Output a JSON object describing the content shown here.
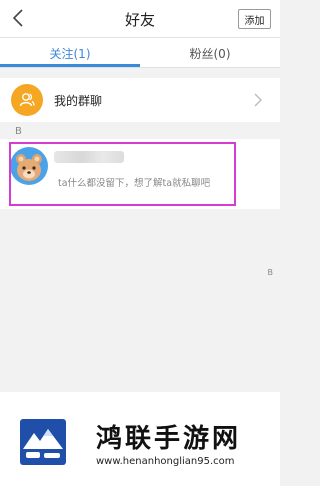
{
  "header": {
    "title": "好友",
    "add_label": "添加"
  },
  "tabs": [
    {
      "label": "关注(1)",
      "active": true
    },
    {
      "label": "粉丝(0)",
      "active": false
    }
  ],
  "group_chat": {
    "label": "我的群聊"
  },
  "section": {
    "letter": "B"
  },
  "friend": {
    "signature": "ta什么都没留下，想了解ta就私聊吧"
  },
  "index_bar": {
    "letter": "B"
  },
  "watermark": {
    "title": "鸿联手游网",
    "url": "www.henanhonglian95.com"
  },
  "colors": {
    "accent": "#3b8ad8",
    "group_icon": "#f5a623",
    "highlight": "#d63bd3"
  }
}
